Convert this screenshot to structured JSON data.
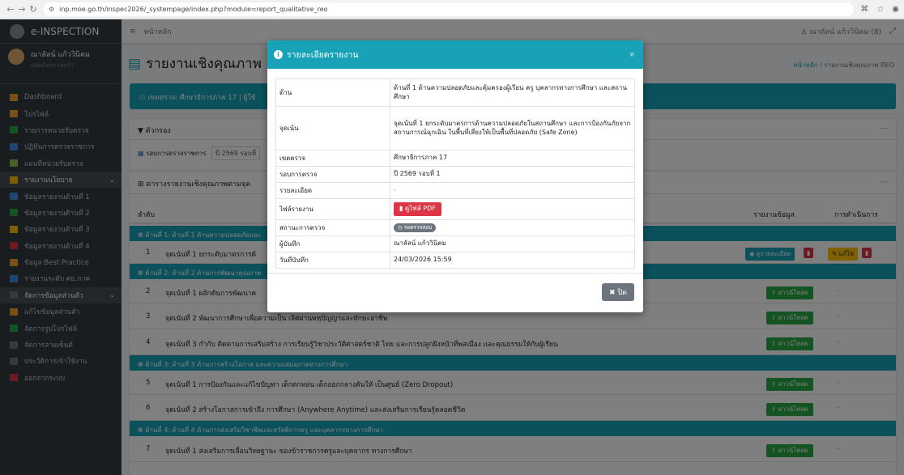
{
  "browser": {
    "url": "inp.moe.go.th/inspec2026/_systempage/index.php?module=report_qualitative_reo",
    "icons": [
      "back-icon",
      "forward-icon",
      "reload-icon",
      "site-settings-icon",
      "translate-icon",
      "bookmark-star-icon",
      "profile-icon"
    ]
  },
  "sidebar": {
    "brand": "e-INSPECTION",
    "user_name": "ณาลัลน์ แก้ววินิคม",
    "user_sub": "ปลัดมัชชร (คศ3)",
    "items": [
      {
        "label": "Dashboard",
        "color": "#f0a030"
      },
      {
        "label": "โปรไฟล์",
        "color": "#f0a030"
      },
      {
        "label": "รายการหน่วยรับตรวจ",
        "color": "#28a745"
      },
      {
        "label": "ปฏิทินการตรวจราชการ",
        "color": "#3d8fe0"
      },
      {
        "label": "แผนที่หน่วยรับตรวจ",
        "color": "#8bc34a"
      },
      {
        "label": "รายงานนโยบาย",
        "color": "#ffc107",
        "active": true,
        "chev": "⌄"
      },
      {
        "label": "ข้อมูลรายงานด้านที่ 1",
        "color": "#3d8fe0"
      },
      {
        "label": "ข้อมูลรายงานด้านที่ 2",
        "color": "#28a745"
      },
      {
        "label": "ข้อมูลรายงานด้านที่ 3",
        "color": "#ffc107"
      },
      {
        "label": "ข้อมูลรายงานด้านที่ 4",
        "color": "#dc3545"
      },
      {
        "label": "ข้อมูล Best Practice",
        "color": "#f0a030"
      },
      {
        "label": "รายงานระดับ ศธ.ภาค",
        "color": "#3d8fe0"
      },
      {
        "label": "จัดการข้อมูลส่วนตัว",
        "color": "#6c757d",
        "active": true,
        "chev": "⌄"
      },
      {
        "label": "แก้ไขข้อมูลส่วนตัว",
        "color": "#f0a030"
      },
      {
        "label": "จัดการรูปโปรไฟล์",
        "color": "#28a745"
      },
      {
        "label": "จัดการลายเซ็นต์",
        "color": "#6c757d"
      },
      {
        "label": "ประวัติการเข้าใช้งาน",
        "color": "#6c757d"
      },
      {
        "label": "ออกจากระบบ",
        "color": "#dc3545"
      }
    ]
  },
  "topnav": {
    "home": "หน้าหลัก",
    "user": "ณาลัลน์ แก้ววินิคม (8)"
  },
  "content": {
    "title": "รายงานเชิงคุณภาพ (",
    "breadcrumb_home": "หน้าหลัก",
    "breadcrumb_current": "รายงานเชิงคุณภาพ REO",
    "info_text": "เขตตรวจ: ศึกษาธิการภาค 17  |  ผู้ใช้",
    "filter_title": "ตัวกรอง",
    "filter_round_label": "รอบการตรวจราชการ",
    "filter_round_value": "ปี 2569 รอบที่",
    "table_title": "ตารางรายงานเชิงคุณภาพตามจุด",
    "col_no": "ลำดับ",
    "col_report": "รายงานข้อมูล",
    "col_action": "การดำเนินการ",
    "btn_download": "ดาวน์โหลด",
    "btn_view": "ดูรายละเอียด",
    "btn_edit": "แก้ไข",
    "dash": "–",
    "groups": [
      "ด้านที่ 1: ด้านที่ 1 ด้านความปลอดภัยและ",
      "ด้านที่ 2: ด้านที่ 2 ด้านการพัฒนาคุณภาพ",
      "ด้านที่ 3: ด้านที่ 3 ด้านการสร้างโอกาส และความเสมอภาคทางการศึกษา",
      "ด้านที่ 4: ด้านที่ 4 ด้านการส่งเสริมวิชาชีพและสวัสดิการครู และบุคลากรทางการศึกษา"
    ],
    "rows": [
      {
        "no": "1",
        "text": "จุดเน้นที่ 1 ยกระดับมาตรการด้"
      },
      {
        "no": "2",
        "text": "จุดเน้นที่ 1 ผลักดันการพัฒนาค"
      },
      {
        "no": "3",
        "text": "จุดเน้นที่ 2 พัฒนาการศึกษาเพื่อความเป็น เลิศผ่านพหุปัญญาและทักษะอาชีพ"
      },
      {
        "no": "4",
        "text": "จุดเน้นที่ 3 กำกับ ติดตามการเสริมสร้าง การเรียนรู้วิชาประวัติศาสตร์ชาติ ไทย และการปลูกฝังหน้าที่พลเมือง และคุณธรรมให้กับผู้เรียน"
      },
      {
        "no": "5",
        "text": "จุดเน้นที่ 1 การป้องกันและแก้ไขปัญหา เด็กตกหล่น เด็กออกกลางคันให้ เป็นศูนย์ (Zero Dropout)"
      },
      {
        "no": "6",
        "text": "จุดเน้นที่ 2 สร้างโอกาสการเข้าถึง การศึกษา (Anywhere Anytime) และส่งเสริมการเรียนรู้ตลอดชีวิต"
      },
      {
        "no": "7",
        "text": "จุดเน้นที่ 1 ส่งเสริมการเลื่อนวิทยฐานะ ของข้าราชการครูและบุคลากร ทางการศึกษา"
      }
    ]
  },
  "modal": {
    "title": "รายละเอียดรายงาน",
    "close_x": "×",
    "fields": [
      {
        "key": "ด้าน",
        "value": "ด้านที่ 1 ด้านความปลอดภัยและคุ้มครองผู้เรียน ครู บุคลากรทางการศึกษา และสถานศึกษา"
      },
      {
        "key": "จุดเน้น",
        "value": "จุดเน้นที่ 1 ยกระดับมาตรการด้านความปลอดภัยในสถานศึกษา และการป้องกันภัยจากสถานการณ์ฉุกเฉิน ในพื้นที่เสี่ยงให้เป็นพื้นที่ปลอดภัย (Safe Zone)"
      },
      {
        "key": "เขตตรวจ",
        "value": "ศึกษาธิการภาค 17"
      },
      {
        "key": "รอบการตรวจ",
        "value": "ปี 2569 รอบที่ 1"
      },
      {
        "key": "รายละเอียด",
        "value": "-"
      },
      {
        "key": "ไฟล์รายงาน",
        "value": "ดูไฟล์ PDF"
      },
      {
        "key": "สถานะการตรวจ",
        "value": "รอตรวจสอบ"
      },
      {
        "key": "ผู้บันทึก",
        "value": "ณาลัลน์ แก้ววินิคม"
      },
      {
        "key": "วันที่บันทึก",
        "value": "24/03/2026 15:59"
      }
    ],
    "close_button": "ปิด"
  }
}
